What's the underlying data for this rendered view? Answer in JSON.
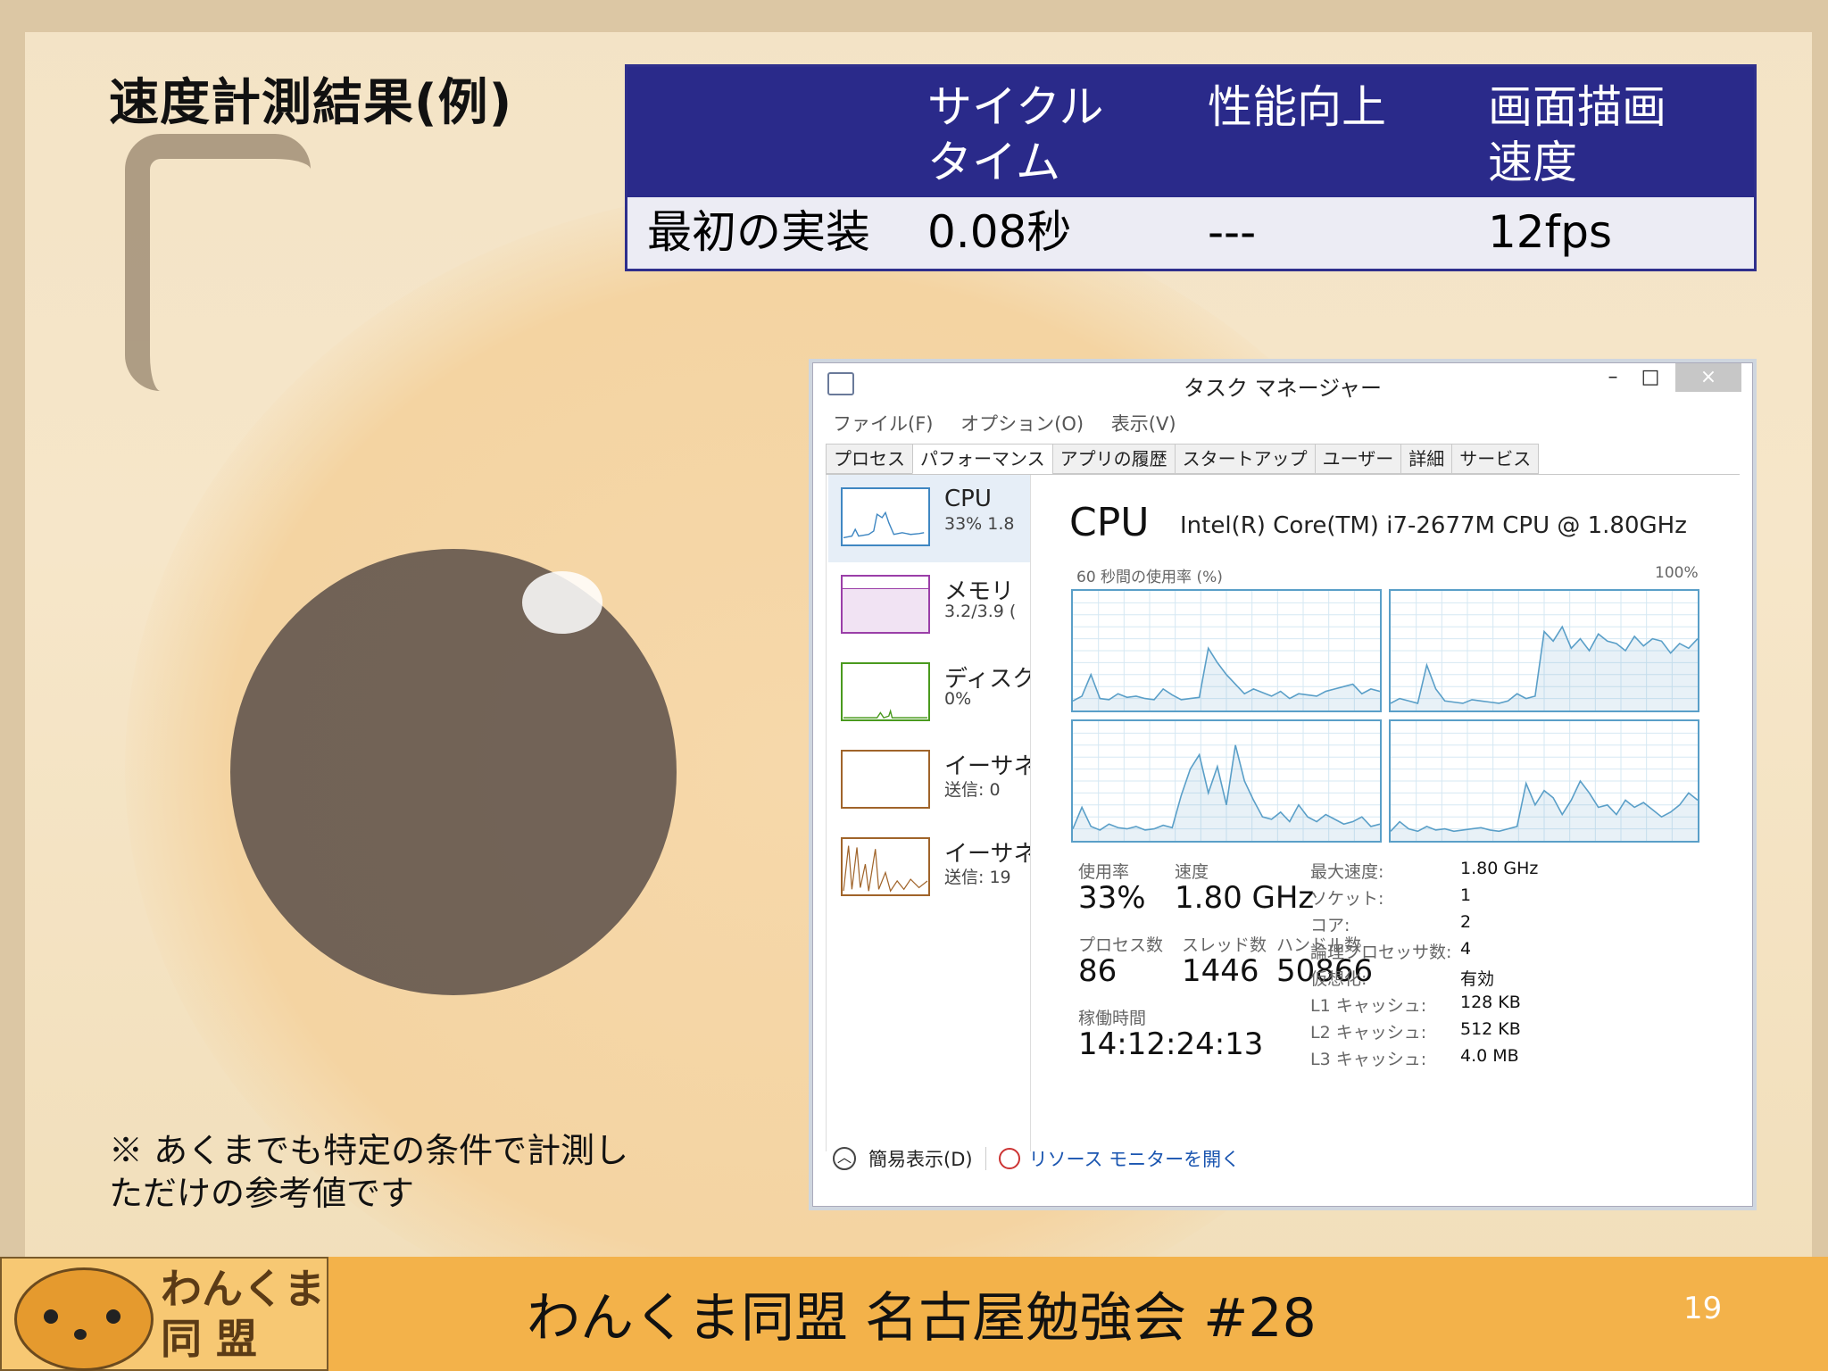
{
  "slide": {
    "title": "速度計測結果(例)",
    "note_line1": "※ あくまでも特定の条件で計測し",
    "note_line2": "ただけの参考値です",
    "footer_title": "わんくま同盟 名古屋勉強会 #28",
    "page_number": "19",
    "logo_line1": "わんくま",
    "logo_line2": "同 盟"
  },
  "table": {
    "headers": [
      "",
      "サイクル\nタイム",
      "性能向上",
      "画面描画\n速度"
    ],
    "header_col2_line1": "サイクル",
    "header_col2_line2": "タイム",
    "header_col3": "性能向上",
    "header_col4_line1": "画面描画",
    "header_col4_line2": "速度",
    "rows": [
      {
        "label": "最初の実装",
        "cycle_time": "0.08秒",
        "improvement": "---",
        "fps": "12fps"
      }
    ]
  },
  "task_manager": {
    "window_title": "タスク マネージャー",
    "window_buttons": {
      "minimize": "–",
      "maximize": "□",
      "close": "×"
    },
    "menu": [
      "ファイル(F)",
      "オプション(O)",
      "表示(V)"
    ],
    "tabs": [
      "プロセス",
      "パフォーマンス",
      "アプリの履歴",
      "スタートアップ",
      "ユーザー",
      "詳細",
      "サービス"
    ],
    "active_tab": "パフォーマンス",
    "sidebar": [
      {
        "name": "CPU",
        "sub": "33% 1.8",
        "color": "#3f87c2"
      },
      {
        "name": "メモリ",
        "sub": "3.2/3.9 (",
        "color": "#9b3fa8"
      },
      {
        "name": "ディスク",
        "sub": "0%",
        "color": "#4a9a1e"
      },
      {
        "name": "イーサネ",
        "sub": "送信: 0 ",
        "color": "#a0642a"
      },
      {
        "name": "イーサネ",
        "sub": "送信: 19",
        "color": "#a0642a"
      }
    ],
    "cpu": {
      "heading": "CPU",
      "model": "Intel(R) Core(TM) i7-2677M CPU @ 1.80GHz",
      "util_label": "60 秒間の使用率 (%)",
      "util_max": "100%",
      "graph_color": "#5a9fc8",
      "core_graphs": [
        [
          8,
          12,
          30,
          10,
          9,
          14,
          11,
          12,
          10,
          9,
          18,
          13,
          9,
          10,
          11,
          52,
          40,
          30,
          22,
          14,
          18,
          15,
          12,
          16,
          10,
          14,
          13,
          12,
          16,
          18,
          20,
          22,
          14,
          18,
          16
        ],
        [
          6,
          10,
          8,
          6,
          38,
          18,
          8,
          7,
          6,
          9,
          8,
          7,
          6,
          8,
          14,
          10,
          12,
          66,
          58,
          70,
          52,
          60,
          50,
          64,
          58,
          56,
          50,
          62,
          54,
          60,
          58,
          48,
          56,
          52,
          60
        ],
        [
          10,
          28,
          12,
          9,
          14,
          11,
          10,
          12,
          9,
          10,
          13,
          11,
          38,
          60,
          72,
          40,
          62,
          30,
          80,
          50,
          34,
          20,
          18,
          24,
          16,
          30,
          20,
          16,
          22,
          18,
          14,
          16,
          20,
          12,
          14
        ],
        [
          8,
          16,
          10,
          8,
          12,
          9,
          10,
          8,
          9,
          10,
          11,
          9,
          8,
          10,
          12,
          48,
          30,
          42,
          36,
          22,
          34,
          50,
          40,
          28,
          30,
          22,
          34,
          28,
          32,
          26,
          20,
          24,
          30,
          40,
          34
        ]
      ],
      "stats": {
        "usage_label": "使用率",
        "usage": "33%",
        "speed_label": "速度",
        "speed": "1.80 GHz",
        "processes_label": "プロセス数",
        "processes": "86",
        "threads_label": "スレッド数",
        "threads": "1446",
        "handles_label": "ハンドル数",
        "handles": "50866",
        "uptime_label": "稼働時間",
        "uptime": "14:12:24:13"
      },
      "info": [
        {
          "label": "最大速度:",
          "value": "1.80 GHz"
        },
        {
          "label": "ソケット:",
          "value": "1"
        },
        {
          "label": "コア:",
          "value": "2"
        },
        {
          "label": "論理プロセッサ数:",
          "value": "4"
        },
        {
          "label": "仮想化:",
          "value": "有効"
        },
        {
          "label": "L1 キャッシュ:",
          "value": "128 KB"
        },
        {
          "label": "L2 キャッシュ:",
          "value": "512 KB"
        },
        {
          "label": "L3 キャッシュ:",
          "value": "4.0 MB"
        }
      ]
    },
    "footer": {
      "fewer_details": "簡易表示(D)",
      "resource_monitor": "リソース モニターを開く"
    }
  }
}
